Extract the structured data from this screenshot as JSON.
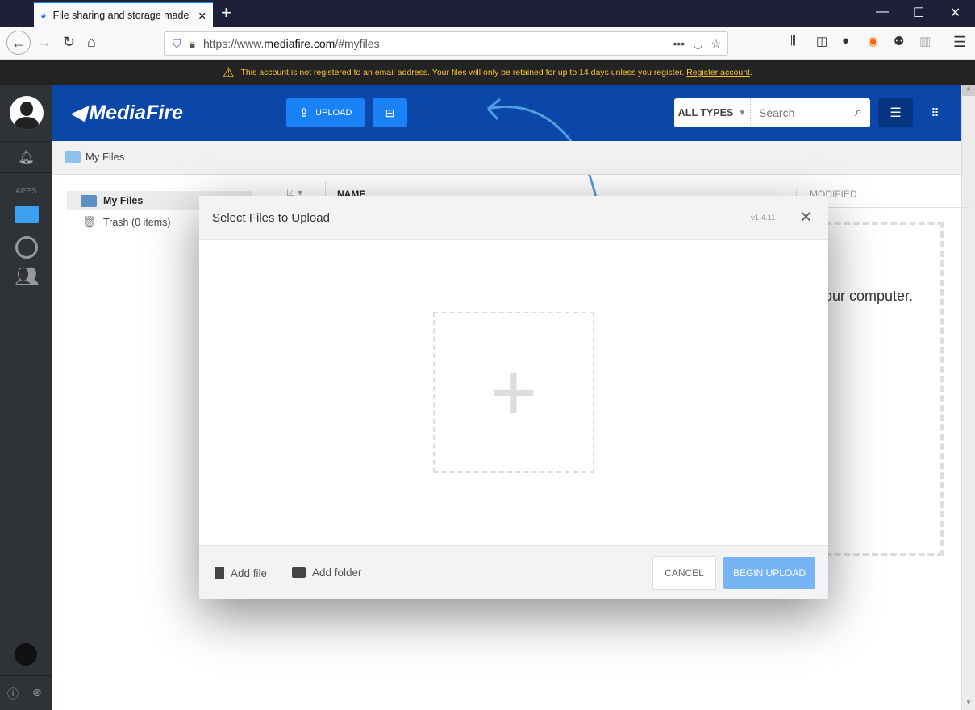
{
  "browser": {
    "tab_title": "File sharing and storage made s",
    "url_prefix": "https://www.",
    "url_domain": "mediafire.com",
    "url_suffix": "/#myfiles"
  },
  "warning": {
    "text": "This account is not registered to an email address. Your files will only be retained for up to 14 days unless you register.",
    "link": "Register account",
    "end": "."
  },
  "header": {
    "logo": "MediaFire",
    "upload_label": "UPLOAD",
    "filter_label": "ALL TYPES",
    "search_placeholder": "Search"
  },
  "sidebar": {
    "apps_label": "APPS"
  },
  "breadcrumb": {
    "label": "My Files"
  },
  "tree": {
    "items": [
      {
        "label": "My Files"
      },
      {
        "label": "Trash (0 items)"
      }
    ]
  },
  "table": {
    "col_name": "NAME",
    "col_modified": "MODIFIED"
  },
  "background": {
    "drop_text": "our computer."
  },
  "modal": {
    "title": "Select Files to Upload",
    "version": "v1.4.11",
    "add_file": "Add file",
    "add_folder": "Add folder",
    "cancel": "CANCEL",
    "begin": "BEGIN UPLOAD"
  }
}
